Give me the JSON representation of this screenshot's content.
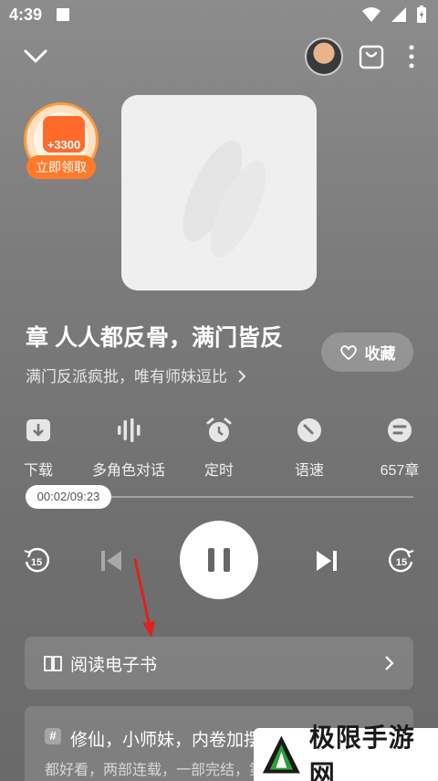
{
  "status_bar": {
    "time": "4:39"
  },
  "reward": {
    "amount": "+3300",
    "button_label": "立即领取"
  },
  "book": {
    "title": "章 人人都反骨，满门皆反",
    "subtitle": "满门反派疯批，唯有师妹逗比",
    "favorite_label": "收藏"
  },
  "tools": [
    {
      "label": "下载",
      "icon": "download-icon"
    },
    {
      "label": "多角色对话",
      "icon": "soundwave-icon"
    },
    {
      "label": "定时",
      "icon": "alarm-icon"
    },
    {
      "label": "语速",
      "icon": "speed-icon"
    },
    {
      "label": "657章",
      "icon": "chapters-icon"
    }
  ],
  "playback": {
    "time_text": "00:02/09:23",
    "progress": 0.0036,
    "rewind_seconds": "15",
    "forward_seconds": "15"
  },
  "read_ebook": {
    "label": "阅读电子书"
  },
  "recommendation": {
    "tag": "#",
    "title": "修仙，小师妹，内卷加摆烂",
    "description": "都好看，两部连载，一部完结，第"
  },
  "watermark": {
    "text": "极限手游网"
  },
  "colors": {
    "accent": "#ff7a2b",
    "annotation_arrow": "#e0201c"
  }
}
